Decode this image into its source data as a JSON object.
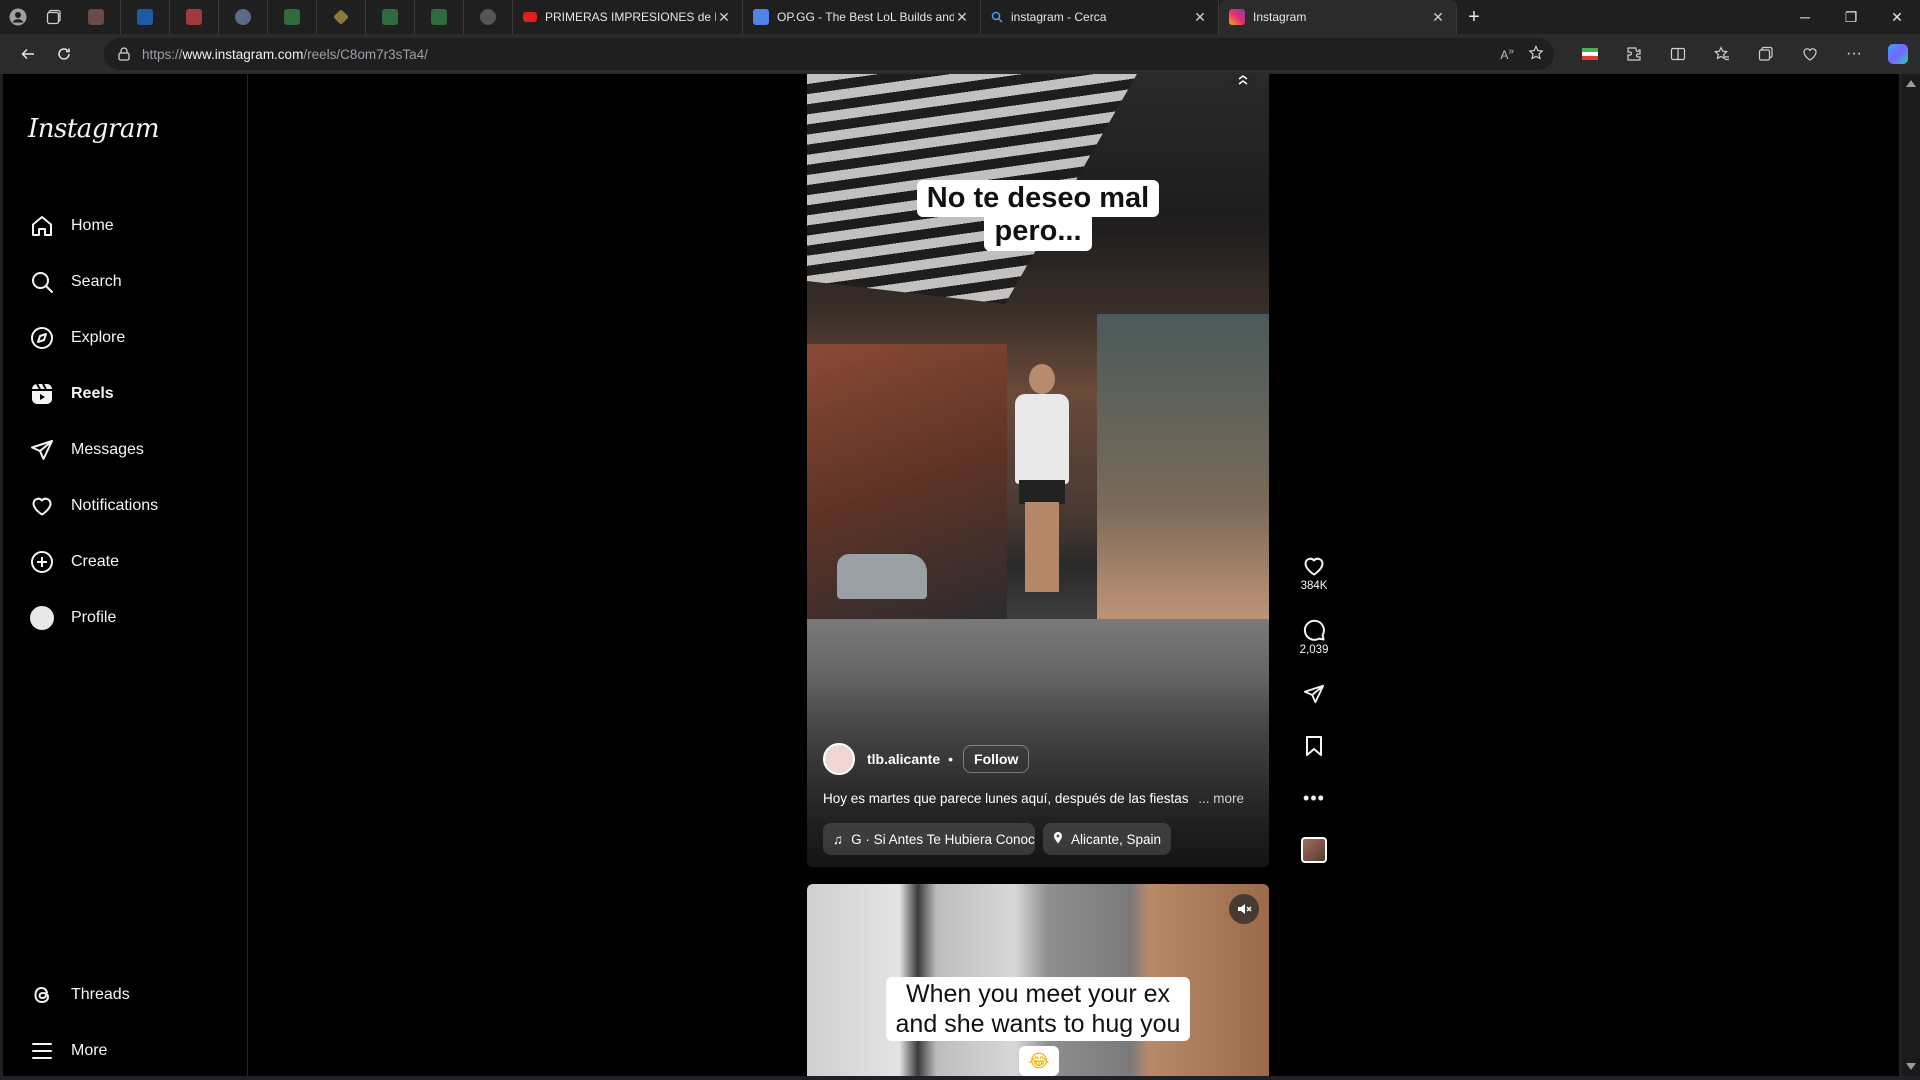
{
  "colors": {
    "accent": "#0095f6",
    "background": "#000000",
    "browser_chrome": "#202124"
  },
  "browser": {
    "tabs": [
      {
        "title": "PRIMERAS IMPRESIONES de K",
        "icon": "youtube-icon"
      },
      {
        "title": "OP.GG - The Best LoL Builds and",
        "icon": "opgg-icon"
      },
      {
        "title": "instagram - Cerca",
        "icon": "search-icon"
      },
      {
        "title": "Instagram",
        "icon": "instagram-icon"
      }
    ],
    "url": {
      "prefix": "https://",
      "host": "www.instagram.com",
      "path": "/reels/C8om7r3sTa4/"
    }
  },
  "sidebar": {
    "logo": "Instagram",
    "items": [
      {
        "label": "Home",
        "icon": "home-icon"
      },
      {
        "label": "Search",
        "icon": "search-icon"
      },
      {
        "label": "Explore",
        "icon": "compass-icon"
      },
      {
        "label": "Reels",
        "icon": "reels-icon"
      },
      {
        "label": "Messages",
        "icon": "paper-plane-icon"
      },
      {
        "label": "Notifications",
        "icon": "heart-icon"
      },
      {
        "label": "Create",
        "icon": "plus-square-icon"
      },
      {
        "label": "Profile",
        "icon": "avatar"
      }
    ],
    "bottom": [
      {
        "label": "Threads",
        "icon": "threads-icon"
      },
      {
        "label": "More",
        "icon": "menu-icon"
      }
    ]
  },
  "reel": {
    "overlay_text_line1": "No te deseo mal",
    "overlay_text_line2": "pero...",
    "username": "tlb.alicante",
    "separator": "•",
    "follow_label": "Follow",
    "caption": "Hoy es martes que parece lunes aquí, después de las fiestas",
    "more_label": "... more",
    "music": "G · Si Antes Te Hubiera Conocido",
    "location": "Alicante, Spain",
    "likes": "384K",
    "comments": "2,039"
  },
  "next_reel": {
    "overlay_line1": "When you meet your ex",
    "overlay_line2": "and she wants to hug you",
    "emoji": "😂"
  }
}
